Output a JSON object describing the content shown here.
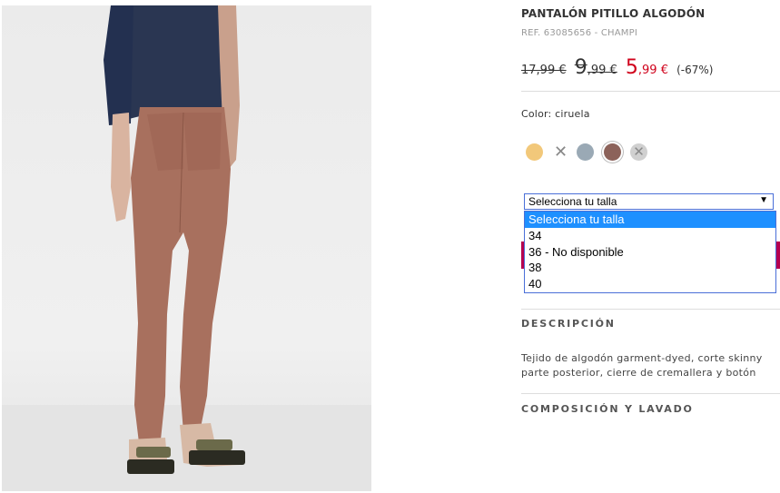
{
  "product": {
    "title": "PANTALÓN PITILLO ALGODÓN",
    "ref": "REF. 63085656 - CHAMPI"
  },
  "prices": {
    "original": "17,99 €",
    "previous_int": "9",
    "previous_dec": ",99 €",
    "current_int": "5",
    "current_dec": ",99 €",
    "discount": "(-67%)"
  },
  "color": {
    "label": "Color: ciruela",
    "swatches": [
      {
        "name": "amarillo",
        "hex": "#f2c87a",
        "available": true
      },
      {
        "name": "no-disponible",
        "available": false
      },
      {
        "name": "azul-gris",
        "hex": "#9aa9b5",
        "available": true
      },
      {
        "name": "ciruela",
        "hex": "#8c625a",
        "available": true,
        "selected": true
      },
      {
        "name": "gris",
        "hex": "#d0d0d0",
        "available": false
      }
    ]
  },
  "size_select": {
    "value": "Selecciona tu talla",
    "arrow": "▼",
    "options": [
      "Selecciona tu talla",
      "34",
      "36 - No disponible",
      "38",
      "40"
    ],
    "highlighted": 0
  },
  "sections": {
    "description_title": "DESCRIPCIÓN",
    "description_line1": "Tejido de algodón garment-dyed, corte skinny",
    "description_line2": "parte posterior, cierre de cremallera y botón",
    "composition_title": "COMPOSICIÓN Y LAVADO"
  },
  "colors": {
    "sale_red": "#d0021b",
    "accent_magenta": "#b5004f",
    "highlight_blue": "#1e90ff"
  }
}
